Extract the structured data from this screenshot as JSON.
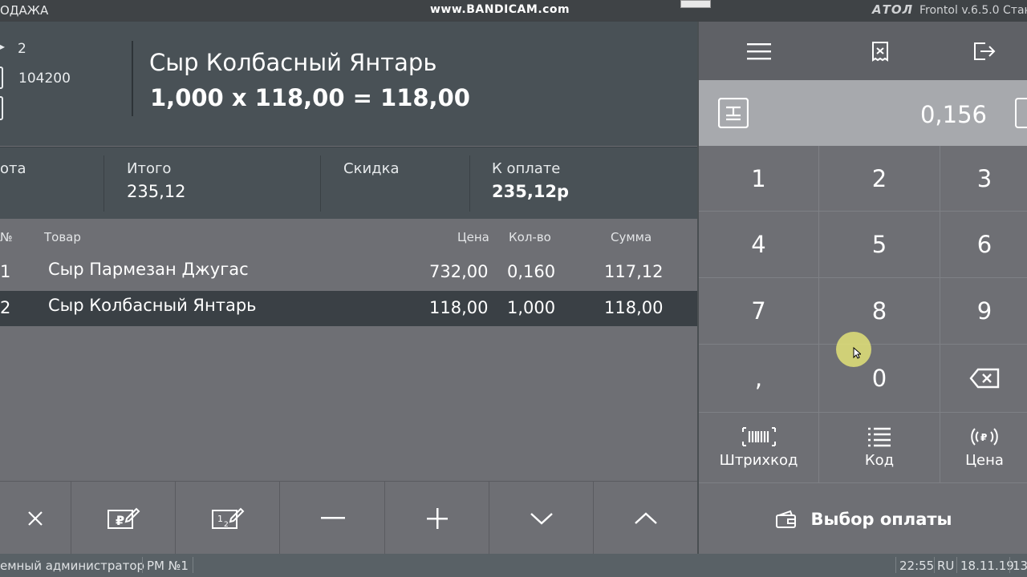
{
  "titlebar": {
    "mode": "ОДАЖА",
    "recorder": "www.BANDICAM.com",
    "brand": "АТОЛ",
    "version": "Frontol v.6.5.0 Стан"
  },
  "info": {
    "line1_value": "2",
    "line2_value": "104200",
    "item_name": "Сыр Колбасный Янтарь",
    "item_calc": "1,000 х 118,00 = 118,00"
  },
  "totals": {
    "c1_label": "ота",
    "c2_label": "Итого",
    "c2_value": "235,12",
    "c3_label": "Скидка",
    "c4_label": "К оплате",
    "c4_value": "235,12р"
  },
  "table": {
    "headers": {
      "num": "№",
      "item": "Товар",
      "price": "Цена",
      "qty": "Кол-во",
      "sum": "Сумма"
    },
    "rows": [
      {
        "num": "1",
        "item": "Сыр Пармезан Джугас",
        "price": "732,00",
        "qty": "0,160",
        "sum": "117,12"
      },
      {
        "num": "2",
        "item": "Сыр Колбасный Янтарь",
        "price": "118,00",
        "qty": "1,000",
        "sum": "118,00"
      }
    ]
  },
  "toolbar": {
    "icons": [
      "close-icon",
      "price-edit-icon",
      "fraction-edit-icon",
      "minus-icon",
      "plus-icon",
      "chevron-down-icon",
      "chevron-up-icon"
    ]
  },
  "keypad": {
    "entry_value": "0,156",
    "keys": [
      "1",
      "2",
      "3",
      "4",
      "5",
      "6",
      "7",
      "8",
      "9",
      ",",
      "0"
    ],
    "barcode_label": "Штрихкод",
    "code_label": "Код",
    "price_label": "Цена",
    "pay_label": "Выбор оплаты"
  },
  "status": {
    "user": "емный администратор",
    "workplace": "РМ №1",
    "time": "22:55",
    "lang": "RU",
    "date": "18.11.19",
    "extra": "13"
  },
  "colors": {
    "header_bg": "#495156",
    "panel_bg": "#6e6f74",
    "selected_row": "#3a4045",
    "entry_bg": "#a7a9ad"
  }
}
